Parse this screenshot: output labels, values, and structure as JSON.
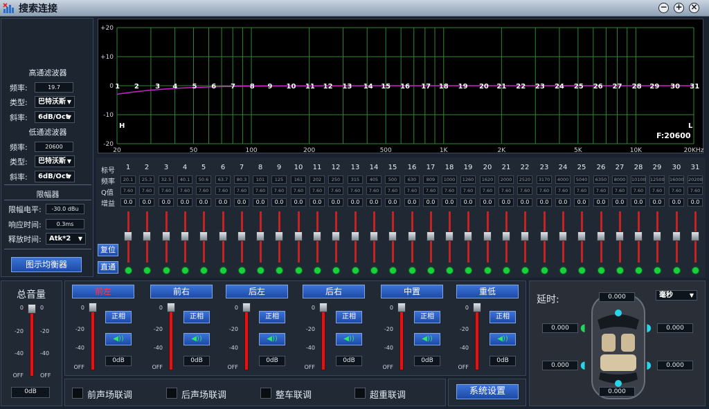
{
  "window": {
    "title": "搜索连接",
    "min_icon": "minimize-icon",
    "max_icon": "maximize-icon",
    "close_icon": "close-icon"
  },
  "left_panel": {
    "highpass_title": "高通滤波器",
    "hp_freq_label": "频率:",
    "hp_freq_value": "19.7",
    "hp_type_label": "类型:",
    "hp_type_value": "巴特沃斯",
    "hp_slope_label": "斜率:",
    "hp_slope_value": "6dB/Oct",
    "lowpass_title": "低通滤波器",
    "lp_freq_label": "频率:",
    "lp_freq_value": "20600",
    "lp_type_label": "类型:",
    "lp_type_value": "巴特沃斯",
    "lp_slope_label": "斜率:",
    "lp_slope_value": "6dB/Oct",
    "limiter_title": "限幅器",
    "lim_level_label": "限幅电平:",
    "lim_level_value": "-30.0 dBu",
    "attack_label": "响应时间:",
    "attack_value": "0.3ms",
    "release_label": "释放时间:",
    "release_value": "Atk*2",
    "eq_button": "图示均衡器"
  },
  "graph": {
    "y_ticks": [
      "+20",
      "+10",
      "0",
      "-10",
      "-20"
    ],
    "x_ticks": [
      "20",
      "50",
      "100",
      "200",
      "500",
      "1K",
      "2K",
      "5K",
      "10K",
      "20KHz"
    ],
    "h_marker": "H",
    "l_marker": "L",
    "freq_readout": "F:20600",
    "line_color": "#d21fd2",
    "grid_color": "#2f8a2f"
  },
  "eq": {
    "row_labels": {
      "index": "标号",
      "freq": "频率",
      "q": "Q值",
      "gain": "增益"
    },
    "channels": [
      "1",
      "2",
      "3",
      "4",
      "5",
      "6",
      "7",
      "8",
      "9",
      "10",
      "11",
      "12",
      "13",
      "14",
      "15",
      "16",
      "17",
      "18",
      "19",
      "20",
      "21",
      "22",
      "23",
      "24",
      "25",
      "26",
      "27",
      "28",
      "29",
      "30",
      "31"
    ],
    "freqs": [
      "20.1",
      "25.3",
      "32.5",
      "40.1",
      "50.6",
      "63.7",
      "80.3",
      "101",
      "125",
      "161",
      "202",
      "250",
      "315",
      "405",
      "500",
      "630",
      "809",
      "1000",
      "1260",
      "1620",
      "2000",
      "2520",
      "3170",
      "4000",
      "5040",
      "6350",
      "8000",
      "10100",
      "12500",
      "16000",
      "20200"
    ],
    "q": [
      "7.60",
      "7.60",
      "7.60",
      "7.60",
      "7.60",
      "7.60",
      "7.60",
      "7.60",
      "7.60",
      "7.60",
      "7.60",
      "7.60",
      "7.60",
      "7.60",
      "7.60",
      "7.60",
      "7.60",
      "7.60",
      "7.60",
      "7.60",
      "7.60",
      "7.60",
      "7.60",
      "7.60",
      "7.60",
      "7.60",
      "7.60",
      "7.60",
      "7.60",
      "7.60",
      "7.60"
    ],
    "gain": [
      "0.0",
      "0.0",
      "0.0",
      "0.0",
      "0.0",
      "0.0",
      "0.0",
      "0.0",
      "0.0",
      "0.0",
      "0.0",
      "0.0",
      "0.0",
      "0.0",
      "0.0",
      "0.0",
      "0.0",
      "0.0",
      "0.0",
      "0.0",
      "0.0",
      "0.0",
      "0.0",
      "0.0",
      "0.0",
      "0.0",
      "0.0",
      "0.0",
      "0.0",
      "0.0",
      "0.0"
    ],
    "reset_button": "复位",
    "bypass_button": "直通"
  },
  "master": {
    "title": "总音量",
    "value": "0dB",
    "scale": [
      "0",
      "-20",
      "-40",
      "OFF"
    ]
  },
  "channels_out": [
    {
      "name": "前左",
      "phase": "正相",
      "value": "0dB"
    },
    {
      "name": "前右",
      "phase": "正相",
      "value": "0dB"
    },
    {
      "name": "后左",
      "phase": "正相",
      "value": "0dB"
    },
    {
      "name": "后右",
      "phase": "正相",
      "value": "0dB"
    },
    {
      "name": "中置",
      "phase": "正相",
      "value": "0dB"
    },
    {
      "name": "重低",
      "phase": "正相",
      "value": "0dB"
    }
  ],
  "channel_scale": [
    "0",
    "-20",
    "-40",
    "OFF"
  ],
  "links": {
    "front": "前声场联调",
    "rear": "后声场联调",
    "car": "整车联调",
    "sub": "超重联调",
    "settings": "系统设置"
  },
  "delay": {
    "title": "延时:",
    "unit": "毫秒",
    "top": "0.000",
    "fl": "0.000",
    "fr": "0.000",
    "rl": "0.000",
    "rr": "0.000",
    "bottom": "0.000"
  }
}
